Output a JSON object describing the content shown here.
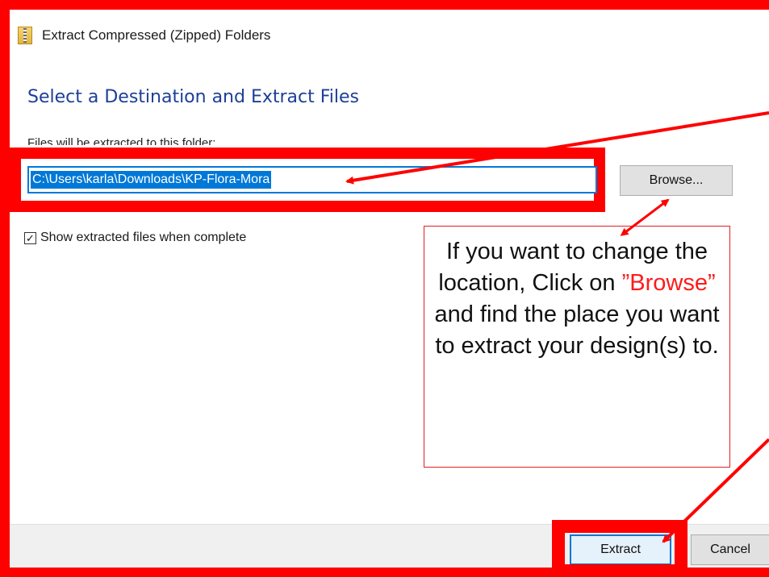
{
  "window": {
    "title": "Extract Compressed (Zipped) Folders",
    "icon": "zip-folder-icon"
  },
  "dialog": {
    "heading": "Select a Destination and Extract Files",
    "path_label": "Files will be extracted to this folder:",
    "path_value": "C:\\Users\\karla\\Downloads\\KP-Flora-Mora",
    "browse_label": "Browse...",
    "checkbox_label": "Show extracted files when complete",
    "checkbox_checked": true
  },
  "footer": {
    "extract_label": "Extract",
    "cancel_label": "Cancel"
  },
  "annotation": {
    "text_before": "If you want to change the location, Click on ",
    "highlight": "”Browse”",
    "text_after": " and find the place you want to extract your design(s) to.",
    "highlight_color": "#ff1a1a",
    "frame_color": "#ff0000"
  }
}
